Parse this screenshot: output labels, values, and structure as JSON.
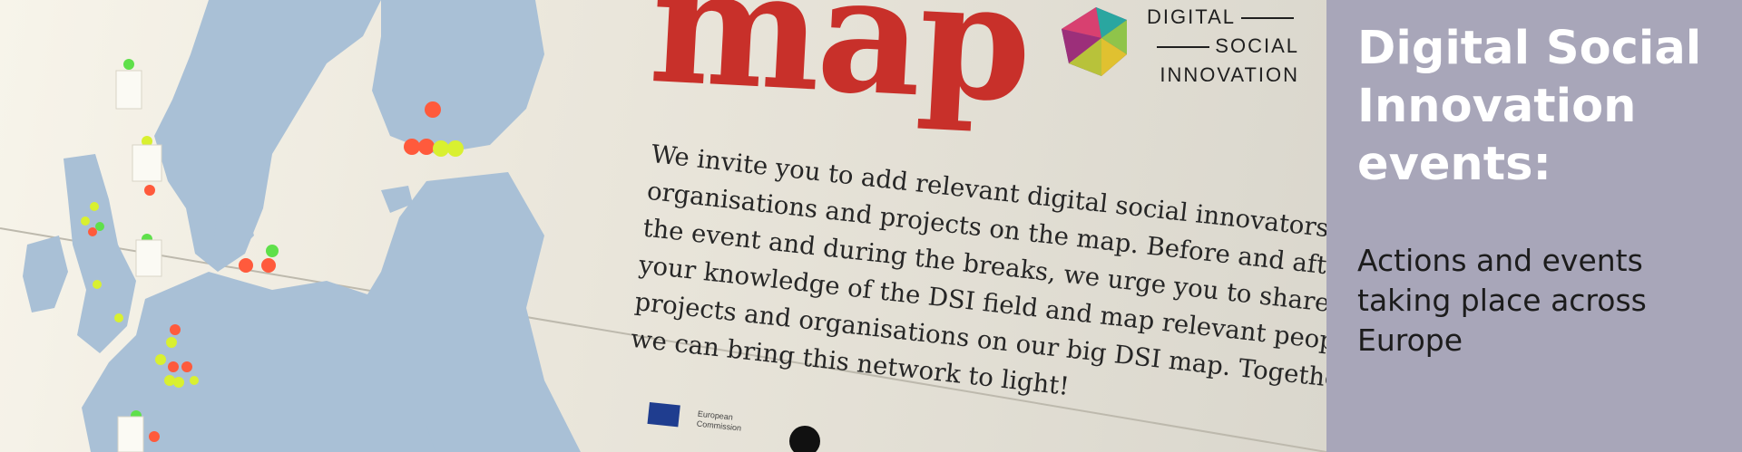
{
  "hero": {
    "title_word": "map",
    "title_color": "#c8302a",
    "map_color": "#a9c0d6",
    "logo": {
      "name_line1": "DIGITAL",
      "name_line2": "SOCIAL",
      "name_line3": "INNOVATION"
    },
    "invite_lines": [
      "We invite you to add relevant digital social innovators,",
      "organisations and projects on the map. Before and after",
      "the event and during the breaks, we urge you to share",
      "your knowledge of the DSI field and map relevant people,",
      "projects and organisations on our big DSI map. Together",
      "we can bring this network to light!"
    ],
    "funder": {
      "line1": "European",
      "line2": "Commission"
    },
    "sticker_colors": [
      "#ff5a3c",
      "#d9f030",
      "#5fe04a"
    ]
  },
  "sidebar": {
    "background": "#a8a6b9",
    "heading_lines": [
      "Digital Social",
      "Innovation",
      "events:"
    ],
    "description_lines": [
      "Actions and events",
      "taking place across",
      "Europe"
    ]
  }
}
